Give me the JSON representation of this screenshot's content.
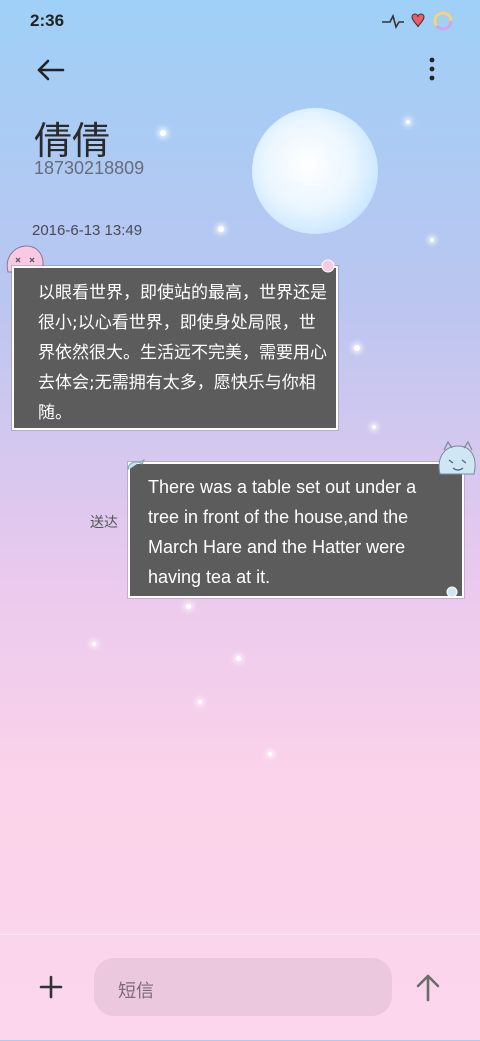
{
  "status_bar": {
    "time": "2:36"
  },
  "header": {
    "contact_name": "倩倩",
    "phone_number": "18730218809"
  },
  "messages": {
    "date": "2016-6-13 13:49",
    "incoming": {
      "text": "以眼看世界，即使站的最高，世界还是很小;以心看世界，即使身处局限，世界依然很大。生活远不完美，需要用心去体会;无需拥有太多，愿快乐与你相随。"
    },
    "outgoing": {
      "text": "There was a table set out under a tree in front of the house,and the March Hare and the Hatter were having tea at it.",
      "status": "送达"
    }
  },
  "composer": {
    "placeholder": "短信"
  },
  "icons": {
    "back": "arrow-left-icon",
    "more": "more-vertical-icon",
    "add": "plus-icon",
    "send": "arrow-up-icon"
  },
  "colors": {
    "bubble": "#5c5c5c",
    "bubble_border": "#ffffff",
    "input_bg": "#ecc8de"
  }
}
